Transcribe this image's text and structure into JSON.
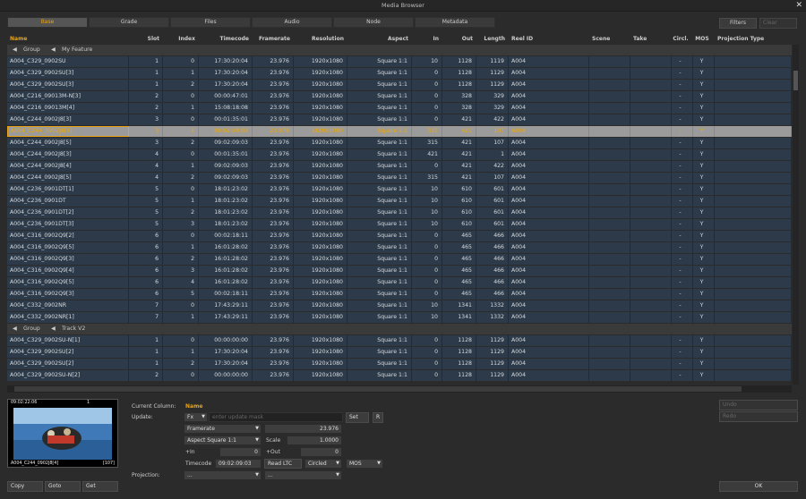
{
  "window": {
    "title": "Media Browser",
    "close": "✕"
  },
  "tabs": [
    "Base",
    "Grade",
    "Files",
    "Audio",
    "Node",
    "Metadata"
  ],
  "filters_label": "Filters",
  "clear_label": "Clear",
  "columns": [
    "Name",
    "Slot",
    "Index",
    "Timecode",
    "Framerate",
    "Resolution",
    "Aspect",
    "In",
    "Out",
    "Length",
    "Reel ID",
    "Scene",
    "Take",
    "Circl.",
    "MOS",
    "Projection Type"
  ],
  "groups": [
    {
      "label": "Group",
      "name": "My Feature"
    },
    {
      "label": "Group",
      "name": "Track V2"
    }
  ],
  "rows1": [
    [
      "A004_C329_0902SU",
      "1",
      "0",
      "17:30:20:04",
      "23.976",
      "1920x1080",
      "Square 1:1",
      "10",
      "1128",
      "1119",
      "A004",
      "",
      "",
      "-",
      "Y",
      ""
    ],
    [
      "A004_C329_0902SU[3]",
      "1",
      "1",
      "17:30:20:04",
      "23.976",
      "1920x1080",
      "Square 1:1",
      "0",
      "1128",
      "1129",
      "A004",
      "",
      "",
      "-",
      "Y",
      ""
    ],
    [
      "A004_C329_0902SU[3]",
      "1",
      "2",
      "17:30:20:04",
      "23.976",
      "1920x1080",
      "Square 1:1",
      "0",
      "1128",
      "1129",
      "A004",
      "",
      "",
      "-",
      "Y",
      ""
    ],
    [
      "A004_C216_09013M-N[3]",
      "2",
      "0",
      "00:00:47:01",
      "23.976",
      "1920x1080",
      "Square 1:1",
      "0",
      "328",
      "329",
      "A004",
      "",
      "",
      "-",
      "Y",
      ""
    ],
    [
      "A004_C216_09013M[4]",
      "2",
      "1",
      "15:08:18:08",
      "23.976",
      "1920x1080",
      "Square 1:1",
      "0",
      "328",
      "329",
      "A004",
      "",
      "",
      "-",
      "Y",
      ""
    ],
    [
      "A004_C244_0902J8[3]",
      "3",
      "0",
      "00:01:35:01",
      "23.976",
      "1920x1080",
      "Square 1:1",
      "0",
      "421",
      "422",
      "A004",
      "",
      "",
      "-",
      "Y",
      ""
    ],
    [
      "A004_C244_0902J8[4]",
      "3",
      "1",
      "09:02:09:03",
      "23.976",
      "1920x1080",
      "Square 1:1",
      "315",
      "421",
      "107",
      "A004",
      "",
      "",
      "-",
      "Y",
      ""
    ],
    [
      "A004_C244_0902J8[5]",
      "3",
      "2",
      "09:02:09:03",
      "23.976",
      "1920x1080",
      "Square 1:1",
      "315",
      "421",
      "107",
      "A004",
      "",
      "",
      "-",
      "Y",
      ""
    ],
    [
      "A004_C244_0902J8[3]",
      "4",
      "0",
      "00:01:35:01",
      "23.976",
      "1920x1080",
      "Square 1:1",
      "421",
      "421",
      "1",
      "A004",
      "",
      "",
      "-",
      "Y",
      ""
    ],
    [
      "A004_C244_0902J8[4]",
      "4",
      "1",
      "09:02:09:03",
      "23.976",
      "1920x1080",
      "Square 1:1",
      "0",
      "421",
      "422",
      "A004",
      "",
      "",
      "-",
      "Y",
      ""
    ],
    [
      "A004_C244_0902J8[5]",
      "4",
      "2",
      "09:02:09:03",
      "23.976",
      "1920x1080",
      "Square 1:1",
      "315",
      "421",
      "107",
      "A004",
      "",
      "",
      "-",
      "Y",
      ""
    ],
    [
      "A004_C236_0901DT[1]",
      "5",
      "0",
      "18:01:23:02",
      "23.976",
      "1920x1080",
      "Square 1:1",
      "10",
      "610",
      "601",
      "A004",
      "",
      "",
      "-",
      "Y",
      ""
    ],
    [
      "A004_C236_0901DT",
      "5",
      "1",
      "18:01:23:02",
      "23.976",
      "1920x1080",
      "Square 1:1",
      "10",
      "610",
      "601",
      "A004",
      "",
      "",
      "-",
      "Y",
      ""
    ],
    [
      "A004_C236_0901DT[2]",
      "5",
      "2",
      "18:01:23:02",
      "23.976",
      "1920x1080",
      "Square 1:1",
      "10",
      "610",
      "601",
      "A004",
      "",
      "",
      "-",
      "Y",
      ""
    ],
    [
      "A004_C236_0901DT[3]",
      "5",
      "3",
      "18:01:23:02",
      "23.976",
      "1920x1080",
      "Square 1:1",
      "10",
      "610",
      "601",
      "A004",
      "",
      "",
      "-",
      "Y",
      ""
    ],
    [
      "A004_C316_0902Q9[2]",
      "6",
      "0",
      "00:02:18:11",
      "23.976",
      "1920x1080",
      "Square 1:1",
      "0",
      "465",
      "466",
      "A004",
      "",
      "",
      "-",
      "Y",
      ""
    ],
    [
      "A004_C316_0902Q9[5]",
      "6",
      "1",
      "16:01:28:02",
      "23.976",
      "1920x1080",
      "Square 1:1",
      "0",
      "465",
      "466",
      "A004",
      "",
      "",
      "-",
      "Y",
      ""
    ],
    [
      "A004_C316_0902Q9[3]",
      "6",
      "2",
      "16:01:28:02",
      "23.976",
      "1920x1080",
      "Square 1:1",
      "0",
      "465",
      "466",
      "A004",
      "",
      "",
      "-",
      "Y",
      ""
    ],
    [
      "A004_C316_0902Q9[4]",
      "6",
      "3",
      "16:01:28:02",
      "23.976",
      "1920x1080",
      "Square 1:1",
      "0",
      "465",
      "466",
      "A004",
      "",
      "",
      "-",
      "Y",
      ""
    ],
    [
      "A004_C316_0902Q9[5]",
      "6",
      "4",
      "16:01:28:02",
      "23.976",
      "1920x1080",
      "Square 1:1",
      "0",
      "465",
      "466",
      "A004",
      "",
      "",
      "-",
      "Y",
      ""
    ],
    [
      "A004_C316_0902Q9[3]",
      "6",
      "5",
      "00:02:18:11",
      "23.976",
      "1920x1080",
      "Square 1:1",
      "0",
      "465",
      "466",
      "A004",
      "",
      "",
      "-",
      "Y",
      ""
    ],
    [
      "A004_C332_0902NR",
      "7",
      "0",
      "17:43:29:11",
      "23.976",
      "1920x1080",
      "Square 1:1",
      "10",
      "1341",
      "1332",
      "A004",
      "",
      "",
      "-",
      "Y",
      ""
    ],
    [
      "A004_C332_0902NR[1]",
      "7",
      "1",
      "17:43:29:11",
      "23.976",
      "1920x1080",
      "Square 1:1",
      "10",
      "1341",
      "1332",
      "A004",
      "",
      "",
      "-",
      "Y",
      ""
    ]
  ],
  "rows2": [
    [
      "A004_C329_0902SU-N[1]",
      "1",
      "0",
      "00:00:00:00",
      "23.976",
      "1920x1080",
      "Square 1:1",
      "0",
      "1128",
      "1129",
      "A004",
      "",
      "",
      "-",
      "Y",
      ""
    ],
    [
      "A004_C329_0902SU[2]",
      "1",
      "1",
      "17:30:20:04",
      "23.976",
      "1920x1080",
      "Square 1:1",
      "0",
      "1128",
      "1129",
      "A004",
      "",
      "",
      "-",
      "Y",
      ""
    ],
    [
      "A004_C329_0902SU[2]",
      "1",
      "2",
      "17:30:20:04",
      "23.976",
      "1920x1080",
      "Square 1:1",
      "0",
      "1128",
      "1129",
      "A004",
      "",
      "",
      "-",
      "Y",
      ""
    ],
    [
      "A004_C329_0902SU-N[2]",
      "2",
      "0",
      "00:00:00:00",
      "23.976",
      "1920x1080",
      "Square 1:1",
      "0",
      "1128",
      "1129",
      "A004",
      "",
      "",
      "-",
      "Y",
      ""
    ]
  ],
  "selected_row": 6,
  "preview": {
    "timecode": "09:02:22:06",
    "counter": "1",
    "name": "A004_C244_0902J8[4]",
    "index": "[107]"
  },
  "panel": {
    "current_column_label": "Current Column:",
    "current_column_value": "Name",
    "update_label": "Update:",
    "fx": "Fx",
    "update_placeholder": "enter update mask",
    "set": "Set",
    "r": "R",
    "framerate_label": "Framerate",
    "framerate_value": "23.976",
    "aspect_label": "Aspect Square 1:1",
    "scale_label": "Scale",
    "scale_value": "1.0000",
    "in_label": "+In",
    "in_value": "0",
    "out_label": "+Out",
    "out_value": "0",
    "timecode_label": "Timecode",
    "timecode_value": "09:02:09:03",
    "readltc": "Read LTC",
    "circled": "Circled",
    "mos": "MOS",
    "projection_label": "Projection:",
    "proj1": "...",
    "proj2": "...",
    "undo": "Undo",
    "redo": "Redo",
    "copy": "Copy",
    "goto": "Goto",
    "get": "Get",
    "ok": "OK"
  }
}
